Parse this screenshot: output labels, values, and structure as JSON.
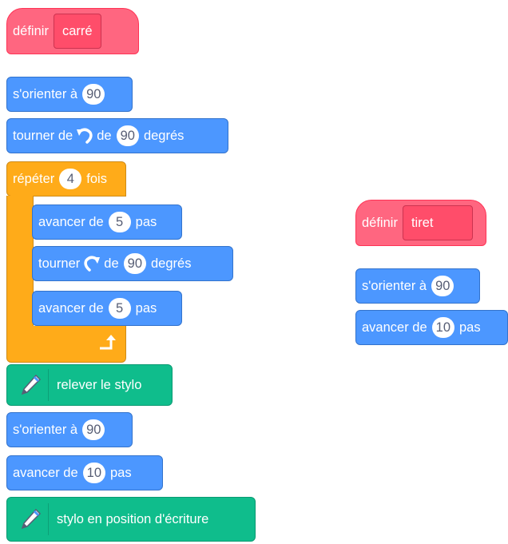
{
  "left_script": {
    "define": {
      "keyword": "définir",
      "name": "carré"
    },
    "orient1": {
      "label": "s'orienter à",
      "value": "90"
    },
    "turn_left": {
      "label_pre": "tourner de",
      "icon": "rotate-left-icon",
      "label_mid": "de",
      "value": "90",
      "label_post": "degrés"
    },
    "repeat": {
      "label_pre": "répéter",
      "value": "4",
      "label_post": "fois",
      "body": [
        {
          "label_pre": "avancer de",
          "value": "5",
          "label_post": "pas"
        },
        {
          "label_pre": "tourner",
          "icon": "rotate-right-icon",
          "label_mid": "de",
          "value": "90",
          "label_post": "degrés"
        },
        {
          "label_pre": "avancer de",
          "value": "5",
          "label_post": "pas"
        }
      ],
      "loop_icon": "loop-arrow-icon"
    },
    "pen_up": {
      "icon": "pen-icon",
      "label": "relever le stylo"
    },
    "orient2": {
      "label": "s'orienter à",
      "value": "90"
    },
    "move": {
      "label_pre": "avancer de",
      "value": "10",
      "label_post": "pas"
    },
    "pen_down": {
      "icon": "pen-icon",
      "label": "stylo en position d'écriture"
    }
  },
  "right_script": {
    "define": {
      "keyword": "définir",
      "name": "tiret"
    },
    "orient": {
      "label": "s'orienter à",
      "value": "90"
    },
    "move": {
      "label_pre": "avancer de",
      "value": "10",
      "label_post": "pas"
    }
  },
  "colors": {
    "motion": "#4c97ff",
    "pen": "#0fbd8c",
    "define": "#ff6680",
    "control": "#ffab19"
  }
}
